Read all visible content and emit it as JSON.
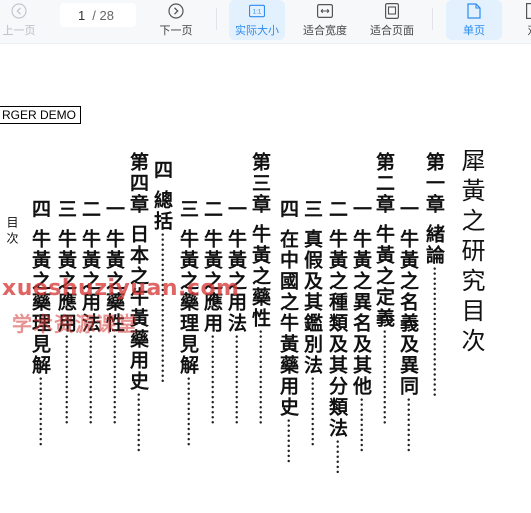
{
  "toolbar": {
    "prev_label": "上一页",
    "page_current": "1",
    "page_total": "/ 28",
    "next_label": "下一页",
    "actual_size_label": "实际大小",
    "actual_size_icon_text": "1:1",
    "fit_width_label": "适合宽度",
    "fit_page_label": "适合页面",
    "single_page_label": "单页",
    "cut_label": "双"
  },
  "document": {
    "stamp": "RGER DEMO",
    "title": "犀黃之研究目次",
    "watermark": "xueshuziyuan.com",
    "watermark2": "学术资源课堂",
    "edge_text": "目 次",
    "columns": [
      {
        "text": "第一章  緒論"
      },
      {
        "text": "一  牛黃之名義及異同"
      },
      {
        "text": "第二章  牛黃之定義"
      },
      {
        "text": "一  牛黃之異名及其他"
      },
      {
        "text": "二  牛黃之種類及其分類法"
      },
      {
        "text": "三  真假及其鑑別法"
      },
      {
        "text": "四  在中國之牛黃藥用史"
      },
      {
        "text": "第三章  牛黃之藥性"
      },
      {
        "text": "一  牛黃之用法"
      },
      {
        "text": "二  牛黃之應用"
      },
      {
        "text": "三  牛黃之藥理見解"
      },
      {
        "text": "四  總括"
      },
      {
        "text": "第四章  日本之牛黃藥用史"
      },
      {
        "text": "一  牛黃之藥性"
      },
      {
        "text": "二  牛黃之用法"
      },
      {
        "text": "三  牛黃之應用"
      },
      {
        "text": "四  牛黃之藥理見解"
      }
    ]
  }
}
